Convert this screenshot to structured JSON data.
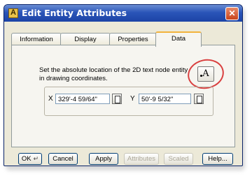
{
  "window": {
    "title": "Edit Entity Attributes",
    "close_label": "✕"
  },
  "tabs": [
    {
      "label": "Information"
    },
    {
      "label": "Display"
    },
    {
      "label": "Properties"
    },
    {
      "label": "Data"
    }
  ],
  "data_tab": {
    "description": "Set the absolute location of the 2D text node entity in drawing coordinates.",
    "text_button_label": "A",
    "x_label": "X",
    "x_value": "329'-4 59/64\"",
    "y_label": "Y",
    "y_value": "50'-9 5/32\""
  },
  "buttons": {
    "ok": "OK",
    "ok_icon": "enter-key-icon",
    "cancel": "Cancel",
    "apply": "Apply",
    "attributes": "Attributes",
    "scaled": "Scaled",
    "help": "Help..."
  },
  "colors": {
    "titlebar": "#2a55b8",
    "dialog_bg": "#ece9d8",
    "active_tab_accent": "#f2b33d",
    "annotation_circle": "#d94040",
    "close_button": "#c8441c"
  }
}
